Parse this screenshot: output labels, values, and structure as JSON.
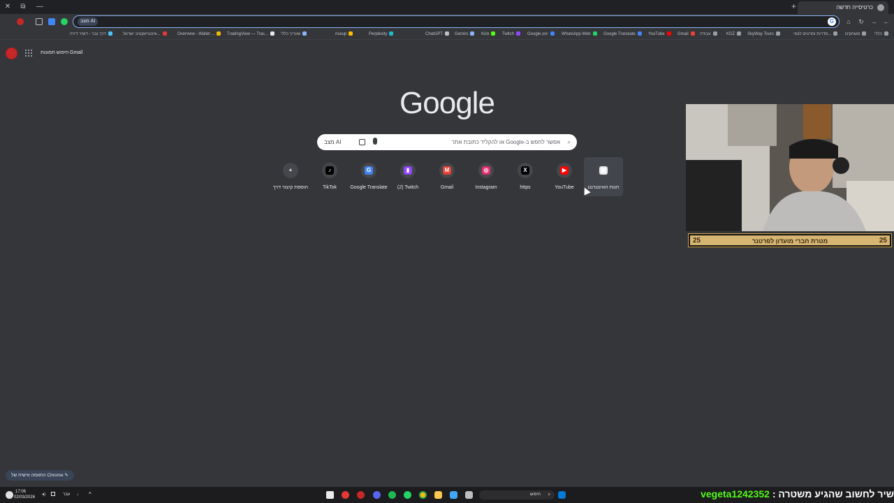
{
  "window": {
    "tab_title": "כרטיסייה חדשה",
    "minimize": "—",
    "restore": "⧉",
    "close": "✕",
    "new_tab": "+",
    "tab_close": "✕"
  },
  "toolbar": {
    "ai_mode_label": "מצב AI",
    "omnibox_value": "",
    "google_icon": "G"
  },
  "bookmarks": [
    {
      "label": "כללי",
      "icon": "folder-icon",
      "color": "#9aa0a6"
    },
    {
      "label": "משחקים",
      "icon": "folder-icon",
      "color": "#9aa0a6"
    },
    {
      "label": "סדרות וסרטים לצפי...",
      "icon": "folder-icon",
      "color": "#9aa0a6"
    },
    {
      "label": "SkyWay Tours",
      "icon": "folder-icon",
      "color": "#9aa0a6"
    },
    {
      "label": "KGZ",
      "icon": "folder-icon",
      "color": "#9aa0a6"
    },
    {
      "label": "עבודה",
      "icon": "folder-icon",
      "color": "#9aa0a6"
    },
    {
      "label": "Gmail",
      "icon": "gmail-icon",
      "color": "#ea4335"
    },
    {
      "label": "YouTube",
      "icon": "youtube-icon",
      "color": "#ff0000"
    },
    {
      "label": "Google Translate",
      "icon": "translate-icon",
      "color": "#4285f4"
    },
    {
      "label": "WhatsApp Web",
      "icon": "whatsapp-icon",
      "color": "#25d366"
    },
    {
      "label": "Google יומן",
      "icon": "calendar-icon",
      "color": "#4285f4"
    },
    {
      "label": "Twitch",
      "icon": "twitch-icon",
      "color": "#9146ff"
    },
    {
      "label": "Kick",
      "icon": "kick-icon",
      "color": "#53fc18"
    },
    {
      "label": "Gemini",
      "icon": "gemini-icon",
      "color": "#8ab4f8"
    },
    {
      "label": "ChatGPT",
      "icon": "chatgpt-icon",
      "color": "#bdc1c6"
    },
    {
      "label": "Perplexity",
      "icon": "perplexity-icon",
      "color": "#20b8cd"
    },
    {
      "label": "riseup",
      "icon": "riseup-icon",
      "color": "#fbbc04"
    },
    {
      "label": "שעריך כללי",
      "icon": "link-icon",
      "color": "#8ab4f8"
    },
    {
      "label": "TradingView — Trac...",
      "icon": "tradingview-icon",
      "color": "#e8eaed"
    },
    {
      "label": "Overview - Wallet ...",
      "icon": "binance-icon",
      "color": "#f0b90b"
    },
    {
      "label": "אינטראקטיב ישראל...",
      "icon": "bank-icon",
      "color": "#e53935"
    },
    {
      "label": "דרך גבר - דשיר דירה",
      "icon": "link-icon",
      "color": "#4fc3f7"
    },
    {
      "label": "כוללת כלי הבינה הח...",
      "icon": "link-icon",
      "color": "#9aa0a6"
    }
  ],
  "page": {
    "gmail_link": "Gmail",
    "images_link": "חיפוש תמונות",
    "logo_text": "Google",
    "search": {
      "placeholder": "אפשר לחפש ב-Google או להקליד כתובת אתר",
      "ai_mode": "מצב AI"
    },
    "customize_label": "התאמה אישית של Chrome"
  },
  "shortcuts": [
    {
      "label": "חנות האינטרנט",
      "icon": "webstore-icon",
      "color": "#e8eaed",
      "glyph": "▣"
    },
    {
      "label": "YouTube",
      "icon": "youtube-icon",
      "color": "#ff0000",
      "glyph": "▶"
    },
    {
      "label": "https",
      "icon": "x-icon",
      "color": "#000000",
      "glyph": "X"
    },
    {
      "label": "Instagram",
      "icon": "instagram-icon",
      "color": "#e1306c",
      "glyph": "◎"
    },
    {
      "label": "Gmail",
      "icon": "gmail-icon",
      "color": "#ea4335",
      "glyph": "M"
    },
    {
      "label": "(2) Twitch",
      "icon": "twitch-icon",
      "color": "#9146ff",
      "glyph": "▮"
    },
    {
      "label": "Google Translate",
      "icon": "translate-icon",
      "color": "#4285f4",
      "glyph": "G"
    },
    {
      "label": "TikTok",
      "icon": "tiktok-icon",
      "color": "#000000",
      "glyph": "♪"
    },
    {
      "label": "הוספת קיצור דרך",
      "icon": "plus-icon",
      "color": "#45474c",
      "glyph": "+"
    }
  ],
  "overlay": {
    "goal_label": "מטרת חברי מועדון לפרטנר",
    "goal_left": "25",
    "goal_right": "25",
    "ticker_text": "שיר לחשוב שהגיע משטרה :",
    "ticker_user": "vegeta1242352"
  },
  "taskbar": {
    "time": "17:06",
    "date": "02/03/2026",
    "language": "עבר",
    "search_label": "חיפוש"
  }
}
